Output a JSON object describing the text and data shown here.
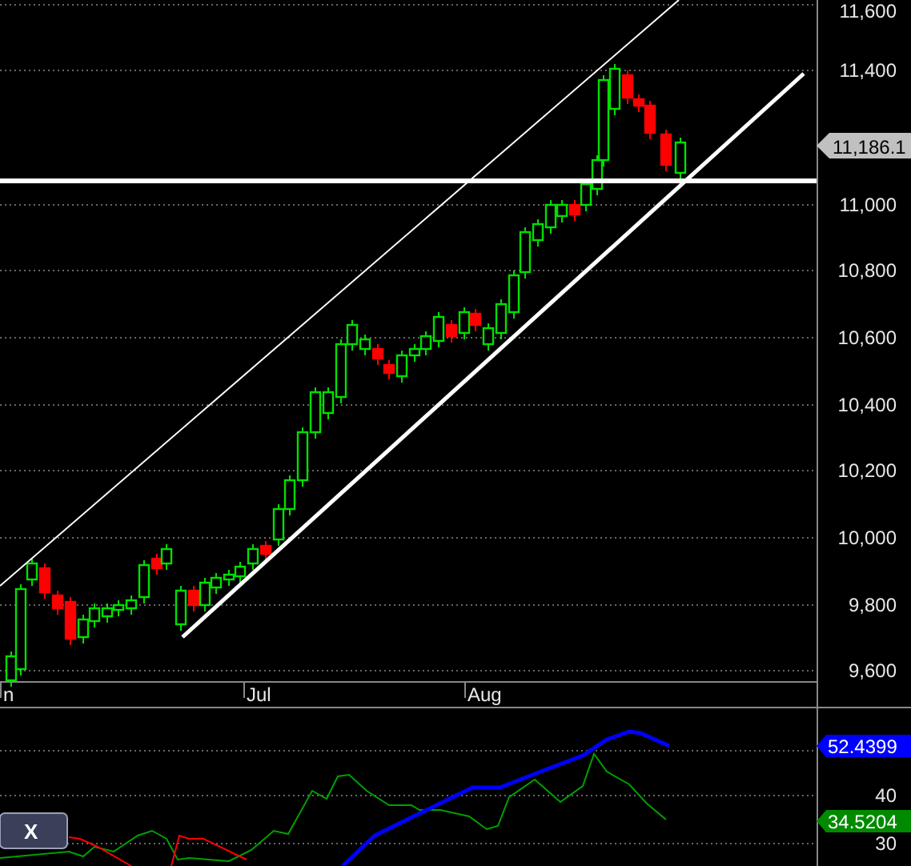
{
  "price_axis": {
    "labels": [
      "11,600",
      "11,400",
      "11,000",
      "10,800",
      "10,600",
      "10,400",
      "10,200",
      "10,000",
      "9,800",
      "9,600"
    ]
  },
  "last_price_tag": {
    "text": "11,186.1"
  },
  "date_axis": {
    "labels": [
      "n",
      "Jul",
      "Aug"
    ]
  },
  "indicator_axis": {
    "labels": [
      "40",
      "30"
    ]
  },
  "indicator_tags": [
    {
      "text": "52.4399",
      "color": "#0000ff"
    },
    {
      "text": "34.5204",
      "color": "#008a00"
    }
  ],
  "close_button": {
    "label": "X"
  }
}
